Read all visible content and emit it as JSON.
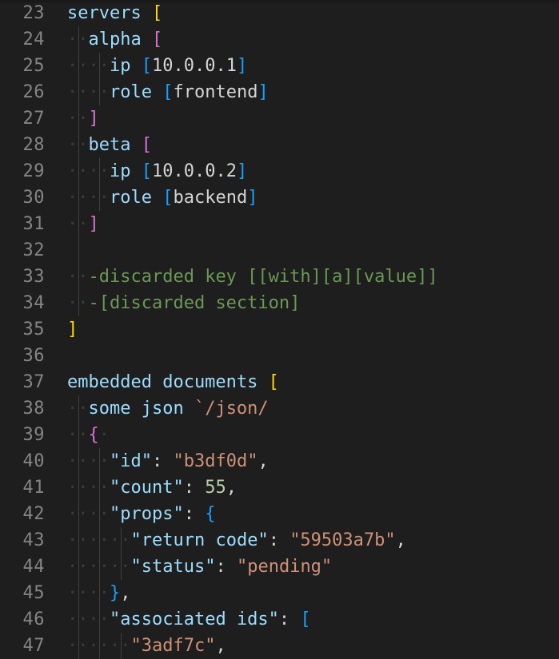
{
  "editor": {
    "name": "code-editor",
    "theme": "dark-plus",
    "background_color": "#1e1e1e",
    "line_number_color": "#858585",
    "indent_guide_color": "#404040",
    "whitespace_dot_color": "#3b3b3b",
    "font_size_px": 22,
    "line_height_px": 33,
    "first_visible_line": 23,
    "last_visible_line": 47,
    "token_colors": {
      "identifier": "#9cdcfe",
      "string": "#ce9178",
      "value": "#d4d4d4",
      "number": "#b5cea8",
      "comment": "#6a9955",
      "bracket_depth_0": "#ffd700",
      "bracket_depth_1": "#da70d6",
      "bracket_depth_2": "#179fff"
    }
  },
  "lines": [
    {
      "number": "23",
      "indent_guides": 0,
      "tokens": [
        {
          "text": "servers ",
          "cls": "t-key"
        },
        {
          "text": "[",
          "cls": "b0"
        }
      ]
    },
    {
      "number": "24",
      "indent_guides": 1,
      "tokens": [
        {
          "text": "··",
          "cls": "ws"
        },
        {
          "text": "alpha ",
          "cls": "t-key"
        },
        {
          "text": "[",
          "cls": "b1"
        }
      ]
    },
    {
      "number": "25",
      "indent_guides": 2,
      "tokens": [
        {
          "text": "··",
          "cls": "ws"
        },
        {
          "text": "··",
          "cls": "ws"
        },
        {
          "text": "ip ",
          "cls": "t-key"
        },
        {
          "text": "[",
          "cls": "b2"
        },
        {
          "text": "10.0.0.1",
          "cls": "t-val"
        },
        {
          "text": "]",
          "cls": "b2"
        }
      ]
    },
    {
      "number": "26",
      "indent_guides": 2,
      "tokens": [
        {
          "text": "··",
          "cls": "ws"
        },
        {
          "text": "··",
          "cls": "ws"
        },
        {
          "text": "role ",
          "cls": "t-key"
        },
        {
          "text": "[",
          "cls": "b2"
        },
        {
          "text": "frontend",
          "cls": "t-val"
        },
        {
          "text": "]",
          "cls": "b2"
        }
      ]
    },
    {
      "number": "27",
      "indent_guides": 1,
      "tokens": [
        {
          "text": "··",
          "cls": "ws"
        },
        {
          "text": "]",
          "cls": "b1"
        }
      ]
    },
    {
      "number": "28",
      "indent_guides": 1,
      "tokens": [
        {
          "text": "··",
          "cls": "ws"
        },
        {
          "text": "beta ",
          "cls": "t-key"
        },
        {
          "text": "[",
          "cls": "b1"
        }
      ]
    },
    {
      "number": "29",
      "indent_guides": 2,
      "tokens": [
        {
          "text": "··",
          "cls": "ws"
        },
        {
          "text": "··",
          "cls": "ws"
        },
        {
          "text": "ip ",
          "cls": "t-key"
        },
        {
          "text": "[",
          "cls": "b2"
        },
        {
          "text": "10.0.0.2",
          "cls": "t-val"
        },
        {
          "text": "]",
          "cls": "b2"
        }
      ]
    },
    {
      "number": "30",
      "indent_guides": 2,
      "tokens": [
        {
          "text": "··",
          "cls": "ws"
        },
        {
          "text": "··",
          "cls": "ws"
        },
        {
          "text": "role ",
          "cls": "t-key"
        },
        {
          "text": "[",
          "cls": "b2"
        },
        {
          "text": "backend",
          "cls": "t-val"
        },
        {
          "text": "]",
          "cls": "b2"
        }
      ]
    },
    {
      "number": "31",
      "indent_guides": 1,
      "tokens": [
        {
          "text": "··",
          "cls": "ws"
        },
        {
          "text": "]",
          "cls": "b1"
        }
      ]
    },
    {
      "number": "32",
      "indent_guides": 1,
      "tokens": []
    },
    {
      "number": "33",
      "indent_guides": 1,
      "tokens": [
        {
          "text": "··",
          "cls": "ws"
        },
        {
          "text": "-discarded key [[with][a][value]]",
          "cls": "t-com"
        }
      ]
    },
    {
      "number": "34",
      "indent_guides": 1,
      "tokens": [
        {
          "text": "··",
          "cls": "ws"
        },
        {
          "text": "-[discarded section]",
          "cls": "t-com"
        }
      ]
    },
    {
      "number": "35",
      "indent_guides": 0,
      "tokens": [
        {
          "text": "]",
          "cls": "b0"
        }
      ]
    },
    {
      "number": "36",
      "indent_guides": 0,
      "tokens": []
    },
    {
      "number": "37",
      "indent_guides": 0,
      "tokens": [
        {
          "text": "embedded documents ",
          "cls": "t-key"
        },
        {
          "text": "[",
          "cls": "b0"
        }
      ]
    },
    {
      "number": "38",
      "indent_guides": 1,
      "tokens": [
        {
          "text": "··",
          "cls": "ws"
        },
        {
          "text": "some json ",
          "cls": "t-key"
        },
        {
          "text": "`/json/",
          "cls": "t-str"
        }
      ]
    },
    {
      "number": "39",
      "indent_guides": 1,
      "tokens": [
        {
          "text": "··",
          "cls": "ws"
        },
        {
          "text": "{",
          "cls": "b1"
        },
        {
          "text": "·",
          "cls": "ws"
        }
      ]
    },
    {
      "number": "40",
      "indent_guides": 2,
      "tokens": [
        {
          "text": "··",
          "cls": "ws"
        },
        {
          "text": "··",
          "cls": "ws"
        },
        {
          "text": "\"id\"",
          "cls": "t-key"
        },
        {
          "text": ": ",
          "cls": "t-punc"
        },
        {
          "text": "\"b3df0d\"",
          "cls": "t-str"
        },
        {
          "text": ",",
          "cls": "t-punc"
        }
      ]
    },
    {
      "number": "41",
      "indent_guides": 2,
      "tokens": [
        {
          "text": "··",
          "cls": "ws"
        },
        {
          "text": "··",
          "cls": "ws"
        },
        {
          "text": "\"count\"",
          "cls": "t-key"
        },
        {
          "text": ": ",
          "cls": "t-punc"
        },
        {
          "text": "55",
          "cls": "t-num"
        },
        {
          "text": ",",
          "cls": "t-punc"
        }
      ]
    },
    {
      "number": "42",
      "indent_guides": 2,
      "tokens": [
        {
          "text": "··",
          "cls": "ws"
        },
        {
          "text": "··",
          "cls": "ws"
        },
        {
          "text": "\"props\"",
          "cls": "t-key"
        },
        {
          "text": ": ",
          "cls": "t-punc"
        },
        {
          "text": "{",
          "cls": "b2"
        }
      ]
    },
    {
      "number": "43",
      "indent_guides": 3,
      "tokens": [
        {
          "text": "··",
          "cls": "ws"
        },
        {
          "text": "··",
          "cls": "ws"
        },
        {
          "text": "··",
          "cls": "ws"
        },
        {
          "text": "\"return code\"",
          "cls": "t-key"
        },
        {
          "text": ": ",
          "cls": "t-punc"
        },
        {
          "text": "\"59503a7b\"",
          "cls": "t-str"
        },
        {
          "text": ",",
          "cls": "t-punc"
        }
      ]
    },
    {
      "number": "44",
      "indent_guides": 3,
      "tokens": [
        {
          "text": "··",
          "cls": "ws"
        },
        {
          "text": "··",
          "cls": "ws"
        },
        {
          "text": "··",
          "cls": "ws"
        },
        {
          "text": "\"status\"",
          "cls": "t-key"
        },
        {
          "text": ": ",
          "cls": "t-punc"
        },
        {
          "text": "\"pending\"",
          "cls": "t-str"
        }
      ]
    },
    {
      "number": "45",
      "indent_guides": 2,
      "tokens": [
        {
          "text": "··",
          "cls": "ws"
        },
        {
          "text": "··",
          "cls": "ws"
        },
        {
          "text": "}",
          "cls": "b2"
        },
        {
          "text": ",",
          "cls": "t-punc"
        }
      ]
    },
    {
      "number": "46",
      "indent_guides": 2,
      "tokens": [
        {
          "text": "··",
          "cls": "ws"
        },
        {
          "text": "··",
          "cls": "ws"
        },
        {
          "text": "\"associated ids\"",
          "cls": "t-key"
        },
        {
          "text": ": ",
          "cls": "t-punc"
        },
        {
          "text": "[",
          "cls": "b2"
        }
      ]
    },
    {
      "number": "47",
      "indent_guides": 3,
      "tokens": [
        {
          "text": "··",
          "cls": "ws"
        },
        {
          "text": "··",
          "cls": "ws"
        },
        {
          "text": "··",
          "cls": "ws"
        },
        {
          "text": "\"3adf7c\"",
          "cls": "t-str"
        },
        {
          "text": ",",
          "cls": "t-punc"
        }
      ]
    }
  ]
}
